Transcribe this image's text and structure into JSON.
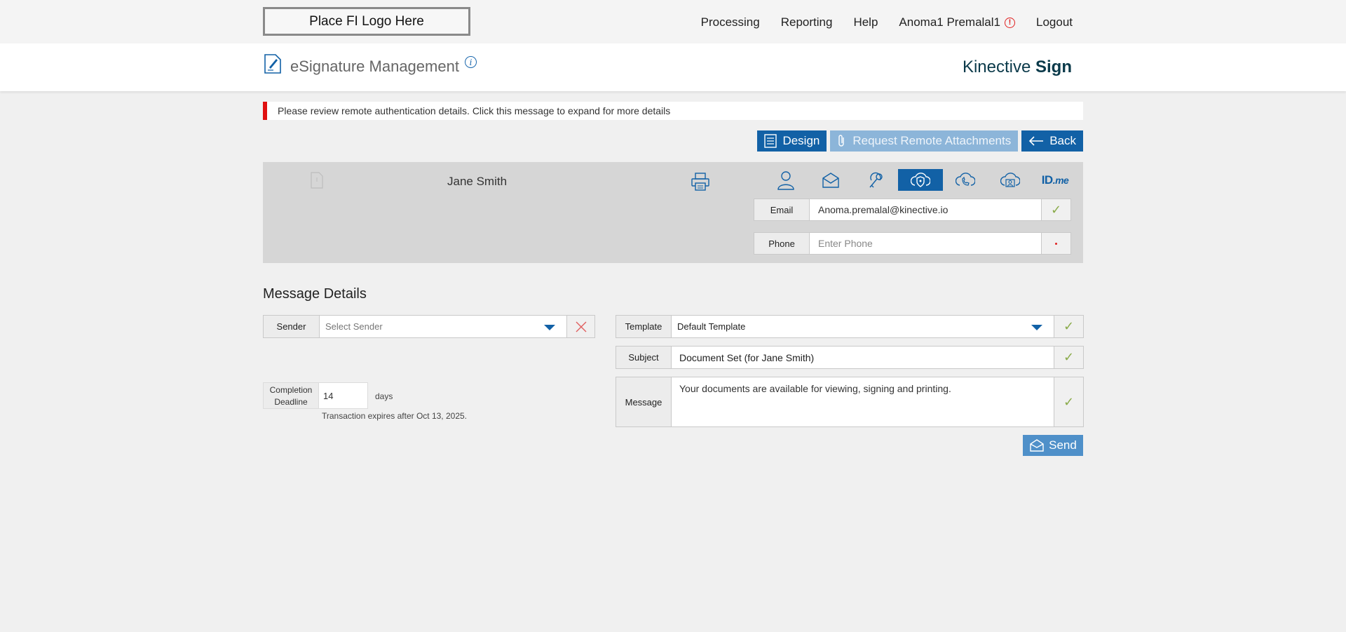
{
  "header": {
    "logo_text": "Place FI Logo Here",
    "nav": [
      "Processing",
      "Reporting",
      "Help"
    ],
    "user_name": "Anoma1 Premalal1",
    "user_alert_icon": "!",
    "logout": "Logout"
  },
  "titlebar": {
    "title": "eSignature Management",
    "info_icon": "i",
    "brand_light": "Kinective ",
    "brand_bold": "Sign"
  },
  "warning": {
    "text": "Please review remote authentication details. Click this message to expand for more details",
    "color": "#e01010"
  },
  "actions": {
    "design": "Design",
    "request_remote_attachments": "Request Remote Attachments",
    "back": "Back"
  },
  "recipient": {
    "name": "Jane Smith",
    "auth_methods": [
      "person-icon",
      "email-icon",
      "key-icon",
      "shield-cloud-icon",
      "phone-icon",
      "cloud-person-icon",
      "idme-icon"
    ],
    "active_auth_index": 3,
    "idme_label": "ID",
    "idme_suffix": ".me",
    "email_label": "Email",
    "email_value": "Anoma.premalal@kinective.io",
    "email_status": "✓",
    "phone_label": "Phone",
    "phone_placeholder": "Enter Phone"
  },
  "message_details": {
    "title": "Message Details",
    "sender_label": "Sender",
    "sender_placeholder": "Select Sender",
    "template_label": "Template",
    "template_value": "Default Template",
    "template_status": "✓",
    "subject_label": "Subject",
    "subject_value": "Document Set (for Jane Smith)",
    "subject_status": "✓",
    "message_label": "Message",
    "message_value": "Your documents are available for viewing, signing and printing.",
    "message_status": "✓",
    "deadline_label_line1": "Completion",
    "deadline_label_line2": "Deadline",
    "deadline_value": "14",
    "deadline_unit": "days",
    "expires_text": "Transaction expires after Oct 13, 2025.",
    "send": "Send"
  },
  "colors": {
    "primary": "#1261a6",
    "primary_light": "#8cb5d9",
    "send": "#4f90c9",
    "check": "#8aab4a",
    "error": "#e02020"
  }
}
